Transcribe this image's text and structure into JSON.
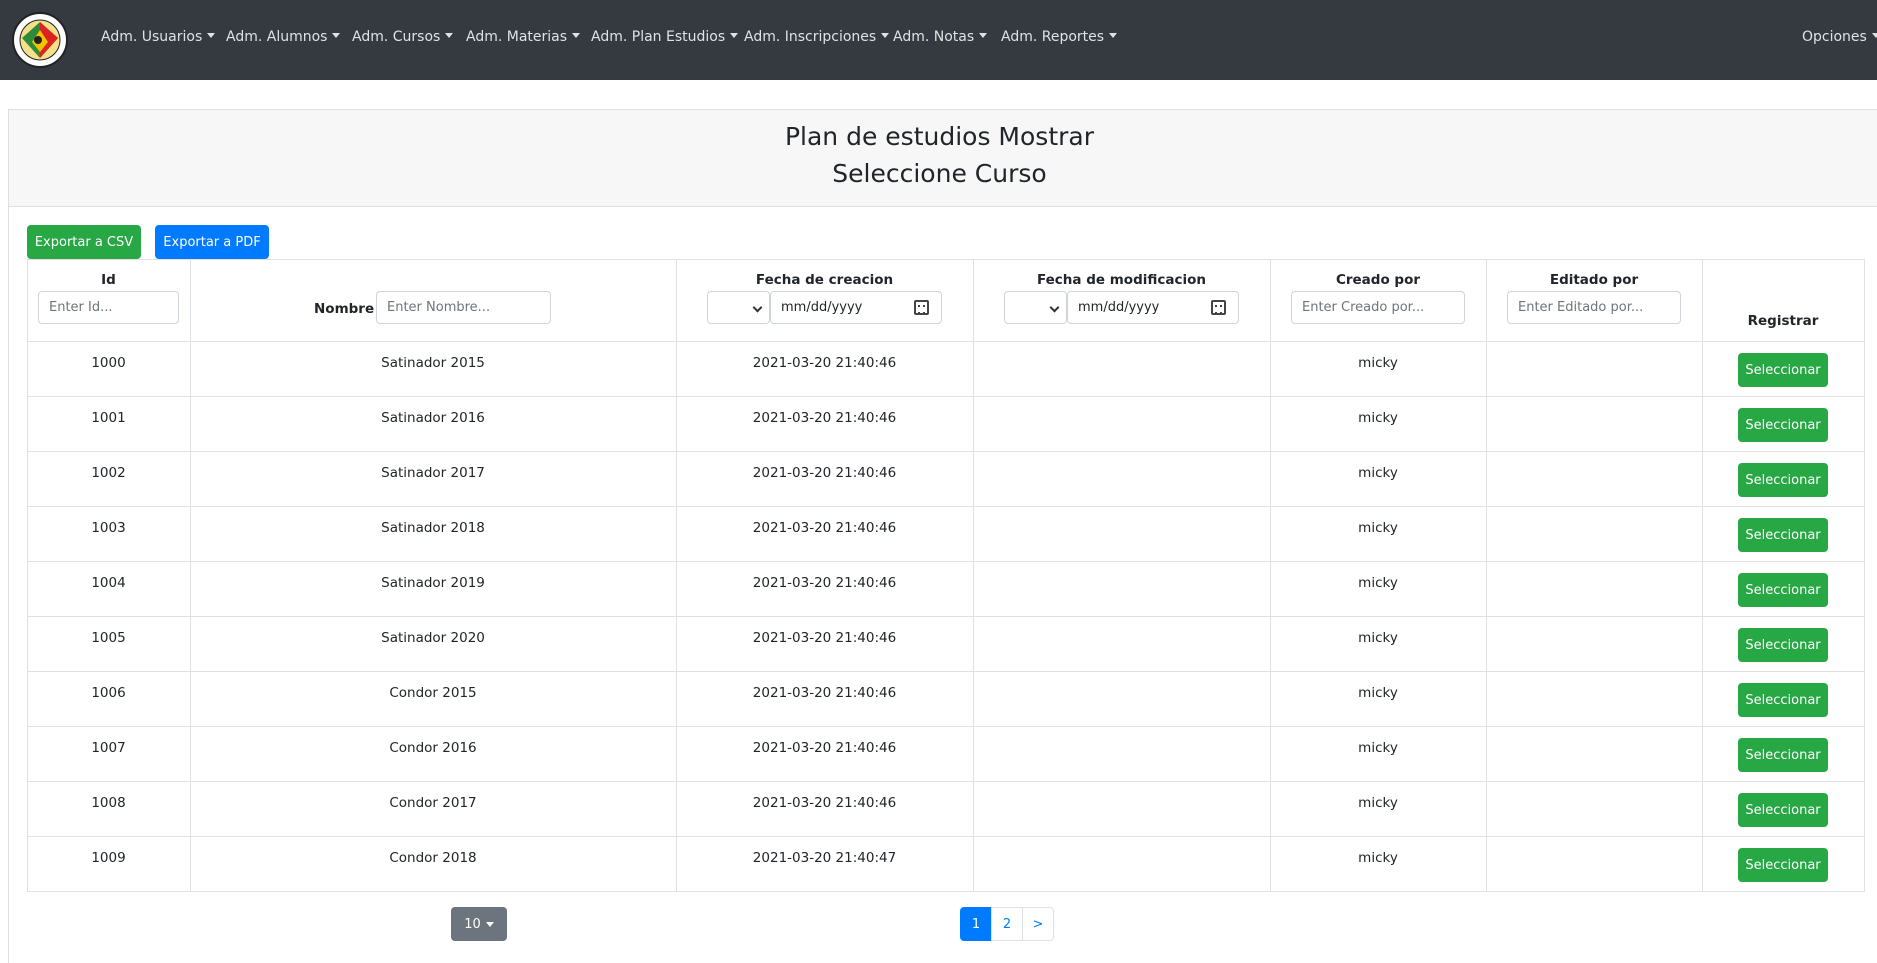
{
  "navbar": {
    "items": [
      {
        "label": "Adm. Usuarios"
      },
      {
        "label": "Adm. Alumnos"
      },
      {
        "label": "Adm. Cursos"
      },
      {
        "label": "Adm. Materias"
      },
      {
        "label": "Adm. Plan Estudios"
      },
      {
        "label": "Adm. Inscripciones"
      },
      {
        "label": "Adm. Notas"
      },
      {
        "label": "Adm. Reportes"
      }
    ],
    "options_label": "Opciones",
    "logo_icon": "school-crest-logo",
    "bg_color": "#343a40"
  },
  "header": {
    "title_line1": "Plan de estudios Mostrar",
    "title_line2": "Seleccione Curso"
  },
  "toolbar": {
    "export_csv_label": "Exportar a CSV",
    "export_pdf_label": "Exportar a PDF"
  },
  "table": {
    "columns": {
      "id": "Id",
      "nombre": "Nombre",
      "fecha_creacion": "Fecha de creacion",
      "fecha_modificacion": "Fecha de modificacion",
      "creado_por": "Creado por",
      "editado_por": "Editado por",
      "registrar": "Registrar"
    },
    "filters": {
      "id_placeholder": "Enter Id...",
      "nombre_placeholder": "Enter Nombre...",
      "fecha_creacion_placeholder": "mm/dd/yyyy",
      "fecha_modificacion_placeholder": "mm/dd/yyyy",
      "creado_por_placeholder": "Enter Creado por...",
      "editado_por_placeholder": "Enter Editado por..."
    },
    "select_button_label": "Seleccionar",
    "rows": [
      {
        "id": "1000",
        "nombre": "Satinador 2015",
        "fecha_creacion": "2021-03-20 21:40:46",
        "fecha_modificacion": "",
        "creado_por": "micky",
        "editado_por": ""
      },
      {
        "id": "1001",
        "nombre": "Satinador 2016",
        "fecha_creacion": "2021-03-20 21:40:46",
        "fecha_modificacion": "",
        "creado_por": "micky",
        "editado_por": ""
      },
      {
        "id": "1002",
        "nombre": "Satinador 2017",
        "fecha_creacion": "2021-03-20 21:40:46",
        "fecha_modificacion": "",
        "creado_por": "micky",
        "editado_por": ""
      },
      {
        "id": "1003",
        "nombre": "Satinador 2018",
        "fecha_creacion": "2021-03-20 21:40:46",
        "fecha_modificacion": "",
        "creado_por": "micky",
        "editado_por": ""
      },
      {
        "id": "1004",
        "nombre": "Satinador 2019",
        "fecha_creacion": "2021-03-20 21:40:46",
        "fecha_modificacion": "",
        "creado_por": "micky",
        "editado_por": ""
      },
      {
        "id": "1005",
        "nombre": "Satinador 2020",
        "fecha_creacion": "2021-03-20 21:40:46",
        "fecha_modificacion": "",
        "creado_por": "micky",
        "editado_por": ""
      },
      {
        "id": "1006",
        "nombre": "Condor 2015",
        "fecha_creacion": "2021-03-20 21:40:46",
        "fecha_modificacion": "",
        "creado_por": "micky",
        "editado_por": ""
      },
      {
        "id": "1007",
        "nombre": "Condor 2016",
        "fecha_creacion": "2021-03-20 21:40:46",
        "fecha_modificacion": "",
        "creado_por": "micky",
        "editado_por": ""
      },
      {
        "id": "1008",
        "nombre": "Condor 2017",
        "fecha_creacion": "2021-03-20 21:40:46",
        "fecha_modificacion": "",
        "creado_por": "micky",
        "editado_por": ""
      },
      {
        "id": "1009",
        "nombre": "Condor 2018",
        "fecha_creacion": "2021-03-20 21:40:47",
        "fecha_modificacion": "",
        "creado_por": "micky",
        "editado_por": ""
      }
    ]
  },
  "pagination": {
    "page_size": "10",
    "pages": [
      "1",
      "2"
    ],
    "next_label": ">",
    "active_page": "1",
    "active_color": "#007bff"
  }
}
